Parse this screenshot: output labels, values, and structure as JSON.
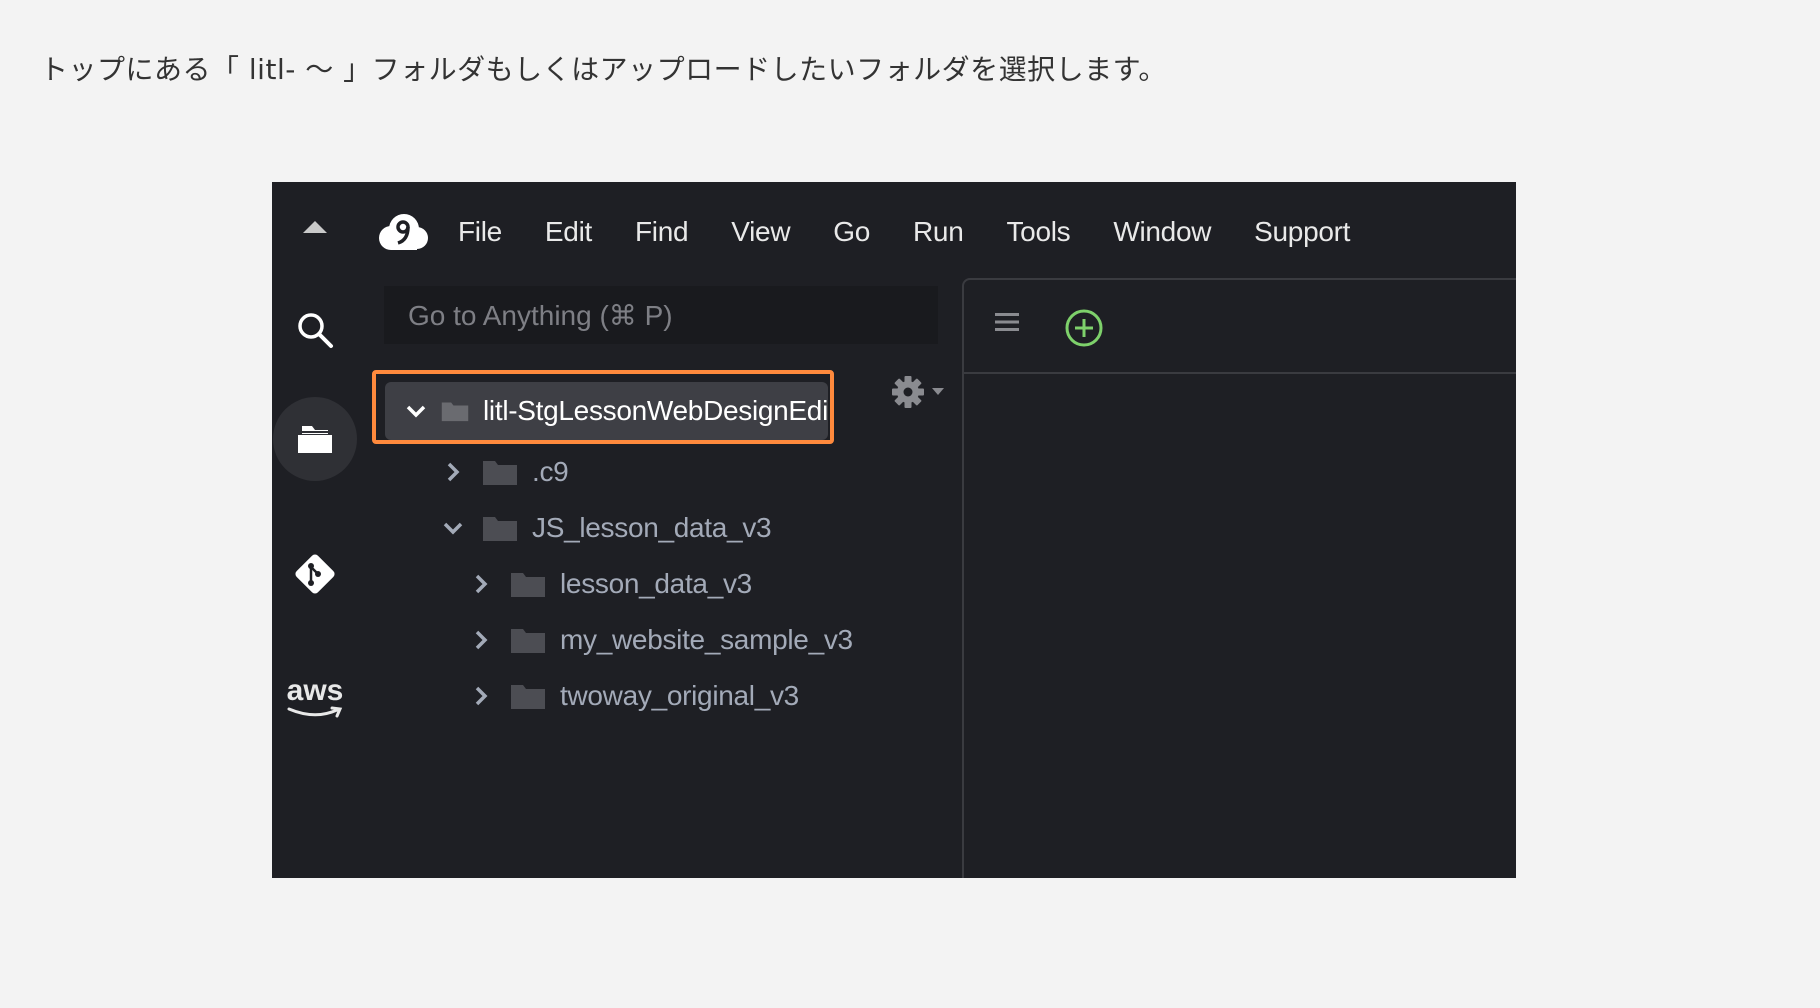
{
  "instruction": "トップにある「 litl- 〜 」フォルダもしくはアップロードしたいフォルダを選択します。",
  "colors": {
    "highlight": "#ff8a3d",
    "ide_bg": "#1e1f24",
    "add_tab": "#7ed16b"
  },
  "ide": {
    "menu": [
      "File",
      "Edit",
      "Find",
      "View",
      "Go",
      "Run",
      "Tools",
      "Window",
      "Support"
    ],
    "goto_placeholder": "Go to Anything (⌘ P)",
    "rail_icons": [
      "collapse-icon",
      "search-icon",
      "files-icon",
      "git-icon",
      "aws-icon"
    ],
    "aws_label": "aws",
    "tree": {
      "root": "litl-StgLessonWebDesignEdi",
      "items": [
        {
          "label": ".c9",
          "expanded": false,
          "depth": 1
        },
        {
          "label": "JS_lesson_data_v3",
          "expanded": true,
          "depth": 1
        },
        {
          "label": "lesson_data_v3",
          "expanded": false,
          "depth": 2
        },
        {
          "label": "my_website_sample_v3",
          "expanded": false,
          "depth": 2
        },
        {
          "label": "twoway_original_v3",
          "expanded": false,
          "depth": 2
        }
      ]
    }
  }
}
